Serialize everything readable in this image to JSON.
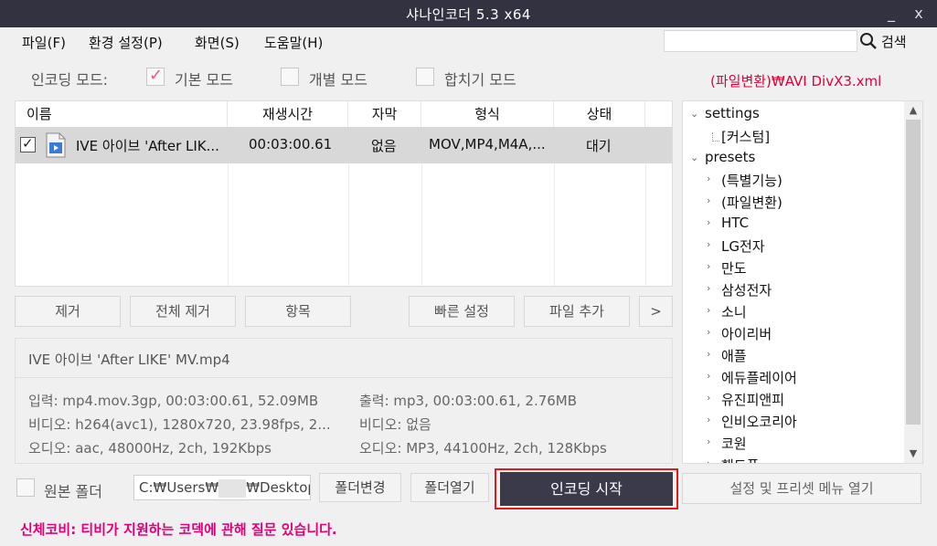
{
  "window": {
    "title": "샤나인코더  5.3 x64",
    "minimize": "_",
    "close": "x"
  },
  "menu": {
    "file": "파일(F)",
    "env": "환경 설정(P)",
    "screen": "화면(S)",
    "help": "도움말(H)"
  },
  "search": {
    "placeholder": "",
    "label": "검색"
  },
  "modes": {
    "label": "인코딩 모드:",
    "basic": "기본 모드",
    "individual": "개별 모드",
    "merge": "합치기 모드"
  },
  "preset_path": "(파일변환)₩AVI DivX3.xml",
  "table": {
    "headers": [
      "이름",
      "재생시간",
      "자막",
      "형식",
      "상태"
    ],
    "rows": [
      {
        "name": "IVE 아이브 'After LIK...",
        "duration": "00:03:00.61",
        "subtitle": "없음",
        "format": "MOV,MP4,M4A,...",
        "status": "대기"
      }
    ]
  },
  "buttons": {
    "remove": "제거",
    "remove_all": "전체 제거",
    "item": "항목",
    "quick_settings": "빠른 설정",
    "add_file": "파일 추가",
    "more": ">",
    "change_folder": "폴더변경",
    "open_folder": "폴더열기",
    "start": "인코딩 시작",
    "settings_menu": "설정 및 프리셋 메뉴 열기"
  },
  "info": {
    "filename": "IVE 아이브 'After LIKE' MV.mp4",
    "input": "입력: mp4.mov.3gp, 00:03:00.61, 52.09MB",
    "video_in": "비디오: h264(avc1), 1280x720, 23.98fps, 2...",
    "audio_in": "오디오: aac, 48000Hz, 2ch, 192Kbps",
    "output": "출력: mp3, 00:03:00.61, 2.76MB",
    "video_out": "비디오: 없음",
    "audio_out": "오디오: MP3, 44100Hz, 2ch, 128Kbps"
  },
  "tree": {
    "settings": "settings",
    "custom": "[커스텀]",
    "presets": "presets",
    "items": [
      "(특별기능)",
      "(파일변환)",
      "HTC",
      "LG전자",
      "만도",
      "삼성전자",
      "소니",
      "아이리버",
      "애플",
      "에듀플레이어",
      "유진피앤피",
      "인비오코리아",
      "코원",
      "핸드폰"
    ]
  },
  "output": {
    "source_folder": "원본 폴더",
    "path_prefix": "C:₩Users₩",
    "path_suffix": "₩Desktop"
  },
  "status_text": "신체코비: 티비가 지원하는 코덱에 관해 질문 있습니다."
}
